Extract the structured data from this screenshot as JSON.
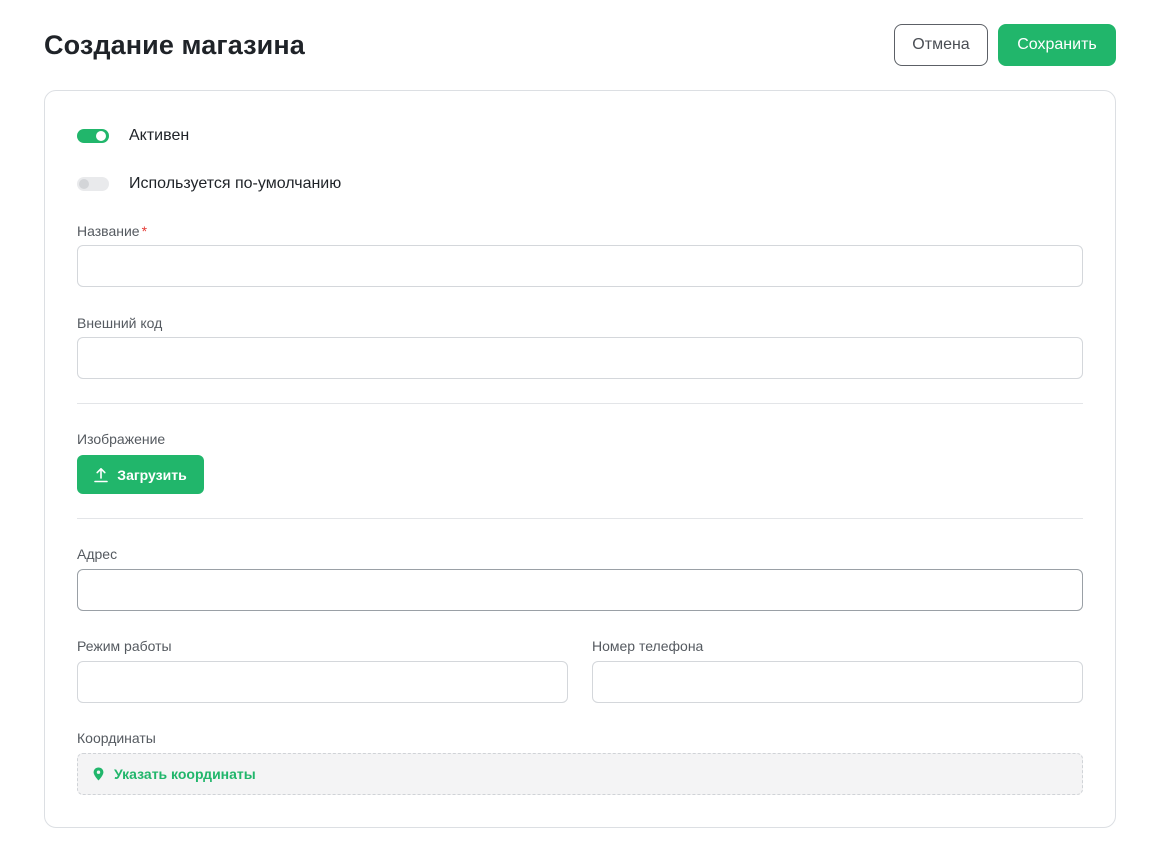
{
  "header": {
    "title": "Создание магазина",
    "cancel_label": "Отмена",
    "save_label": "Сохранить"
  },
  "form": {
    "active_toggle": {
      "label": "Активен",
      "checked": true
    },
    "default_toggle": {
      "label": "Используется по-умолчанию",
      "checked": false
    },
    "name": {
      "label": "Название",
      "required_mark": "*",
      "value": "",
      "placeholder": ""
    },
    "external_code": {
      "label": "Внешний код",
      "value": "",
      "placeholder": ""
    },
    "image": {
      "label": "Изображение",
      "upload_label": "Загрузить",
      "icon": "upload-icon"
    },
    "address": {
      "label": "Адрес",
      "value": "",
      "placeholder": ""
    },
    "work_hours": {
      "label": "Режим работы",
      "value": "",
      "placeholder": ""
    },
    "phone": {
      "label": "Номер телефона",
      "value": "",
      "placeholder": ""
    },
    "coordinates": {
      "label": "Координаты",
      "action_label": "Указать координаты",
      "icon": "map-pin-icon"
    }
  },
  "colors": {
    "accent": "#21b66b",
    "required": "#e53935",
    "text": "#1f2328",
    "label": "#555a60"
  }
}
